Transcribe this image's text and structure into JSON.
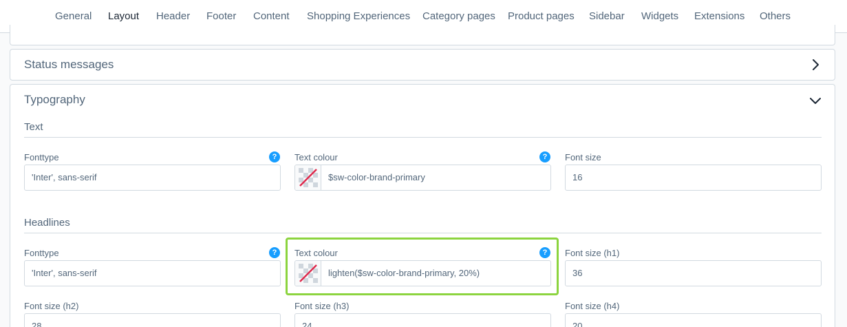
{
  "tabs": [
    {
      "label": "General"
    },
    {
      "label": "Layout",
      "active": true
    },
    {
      "label": "Header"
    },
    {
      "label": "Footer"
    },
    {
      "label": "Content"
    },
    {
      "label": "Shopping Experiences"
    },
    {
      "label": "Category pages"
    },
    {
      "label": "Product pages"
    },
    {
      "label": "Sidebar"
    },
    {
      "label": "Widgets"
    },
    {
      "label": "Extensions"
    },
    {
      "label": "Others"
    }
  ],
  "panels": {
    "status_messages": {
      "title": "Status messages",
      "icon": "chevron-right-icon"
    },
    "typography": {
      "title": "Typography",
      "icon": "chevron-down-icon",
      "expanded": true
    }
  },
  "typography": {
    "text": {
      "title": "Text",
      "fonttype": {
        "label": "Fonttype",
        "value": "'Inter', sans-serif"
      },
      "text_colour": {
        "label": "Text colour",
        "value": "$sw-color-brand-primary"
      },
      "font_size": {
        "label": "Font size",
        "value": "16"
      }
    },
    "headlines": {
      "title": "Headlines",
      "fonttype": {
        "label": "Fonttype",
        "value": "'Inter', sans-serif"
      },
      "text_colour": {
        "label": "Text colour",
        "value": "lighten($sw-color-brand-primary, 20%)"
      },
      "font_size_h1": {
        "label": "Font size (h1)",
        "value": "36"
      },
      "font_size_h2": {
        "label": "Font size (h2)",
        "value": "28"
      },
      "font_size_h3": {
        "label": "Font size (h3)",
        "value": "24"
      },
      "font_size_h4": {
        "label": "Font size (h4)",
        "value": "20"
      }
    }
  },
  "help_icon": "?",
  "colors": {
    "accent": "#189eff",
    "highlight": "#8cd43f",
    "border": "#d1d9e0",
    "text": "#52667a"
  }
}
